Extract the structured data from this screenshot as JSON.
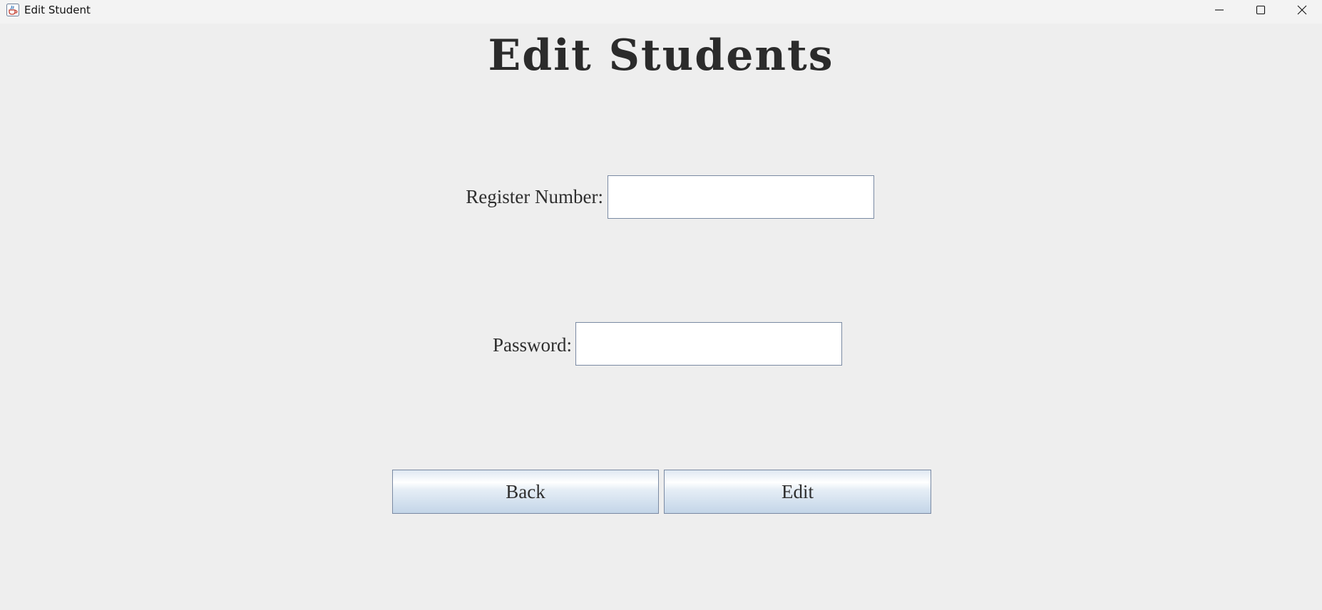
{
  "window": {
    "title": "Edit Student",
    "icon": "java-cup-icon",
    "controls": [
      "minimize-icon",
      "maximize-icon",
      "close-icon"
    ]
  },
  "page": {
    "heading": "Edit Students"
  },
  "form": {
    "register_label": "Register Number:",
    "register_value": "",
    "password_label": "Password:",
    "password_value": ""
  },
  "buttons": {
    "back_label": "Back",
    "edit_label": "Edit"
  },
  "colors": {
    "background": "#eeeeee",
    "titlebar": "#f3f3f3",
    "heading_text": "#2b2b2b",
    "field_border": "#7a8aa3"
  }
}
